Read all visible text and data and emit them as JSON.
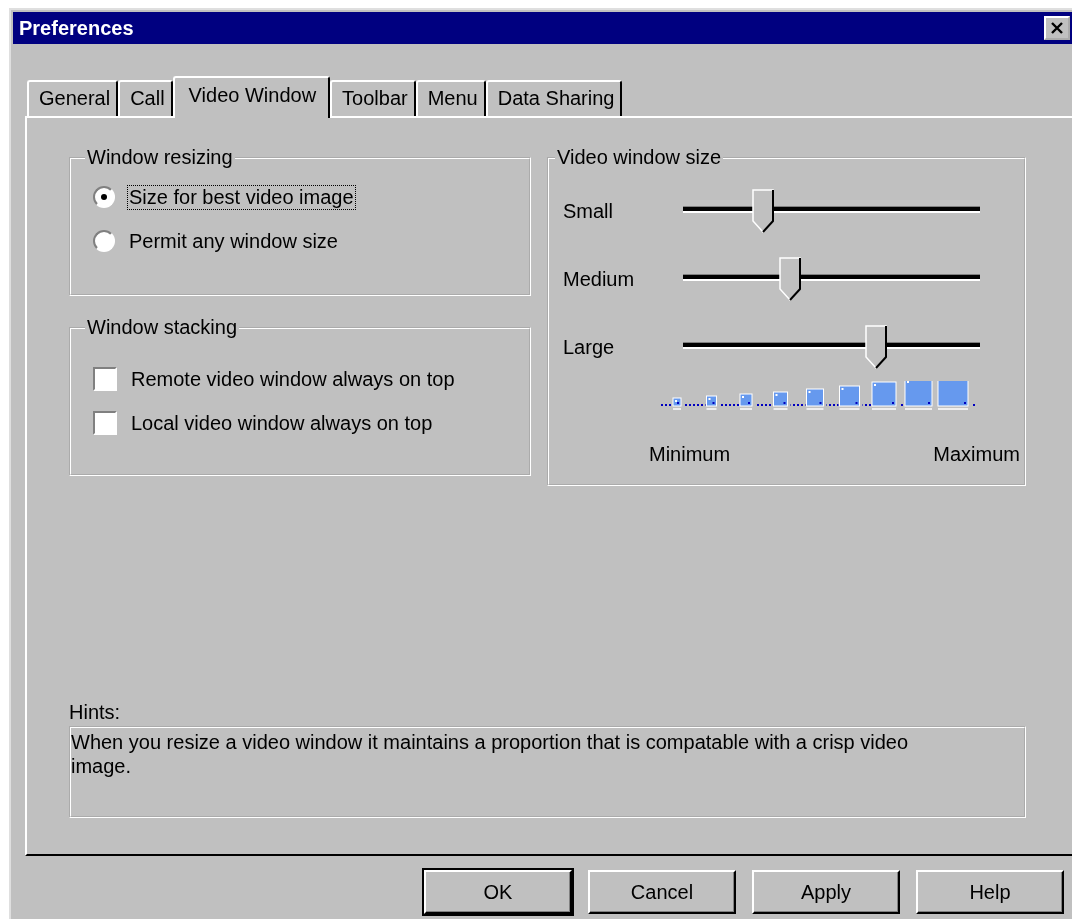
{
  "window": {
    "title": "Preferences"
  },
  "tabs": [
    {
      "label": "General",
      "selected": false
    },
    {
      "label": "Call",
      "selected": false
    },
    {
      "label": "Video Window",
      "selected": true
    },
    {
      "label": "Toolbar",
      "selected": false
    },
    {
      "label": "Menu",
      "selected": false
    },
    {
      "label": "Data Sharing",
      "selected": false
    }
  ],
  "window_resizing": {
    "title": "Window resizing",
    "options": [
      {
        "label": "Size for best video image",
        "selected": true,
        "focused": true
      },
      {
        "label": "Permit any window size",
        "selected": false,
        "focused": false
      }
    ]
  },
  "window_stacking": {
    "title": "Window stacking",
    "options": [
      {
        "label": "Remote video window always on top",
        "checked": false
      },
      {
        "label": "Local video window always on top",
        "checked": false
      }
    ]
  },
  "video_window_size": {
    "title": "Video window size",
    "sliders": [
      {
        "label": "Small",
        "level": 0.27
      },
      {
        "label": "Medium",
        "level": 0.36
      },
      {
        "label": "Large",
        "level": 0.65
      }
    ],
    "min_label": "Minimum",
    "max_label": "Maximum"
  },
  "hints": {
    "label": "Hints:",
    "text": "When you resize a video window it maintains a proportion that is compatable with a crisp video image."
  },
  "buttons": [
    {
      "label": "OK",
      "default": true
    },
    {
      "label": "Cancel",
      "default": false
    },
    {
      "label": "Apply",
      "default": false
    },
    {
      "label": "Help",
      "default": false
    }
  ]
}
